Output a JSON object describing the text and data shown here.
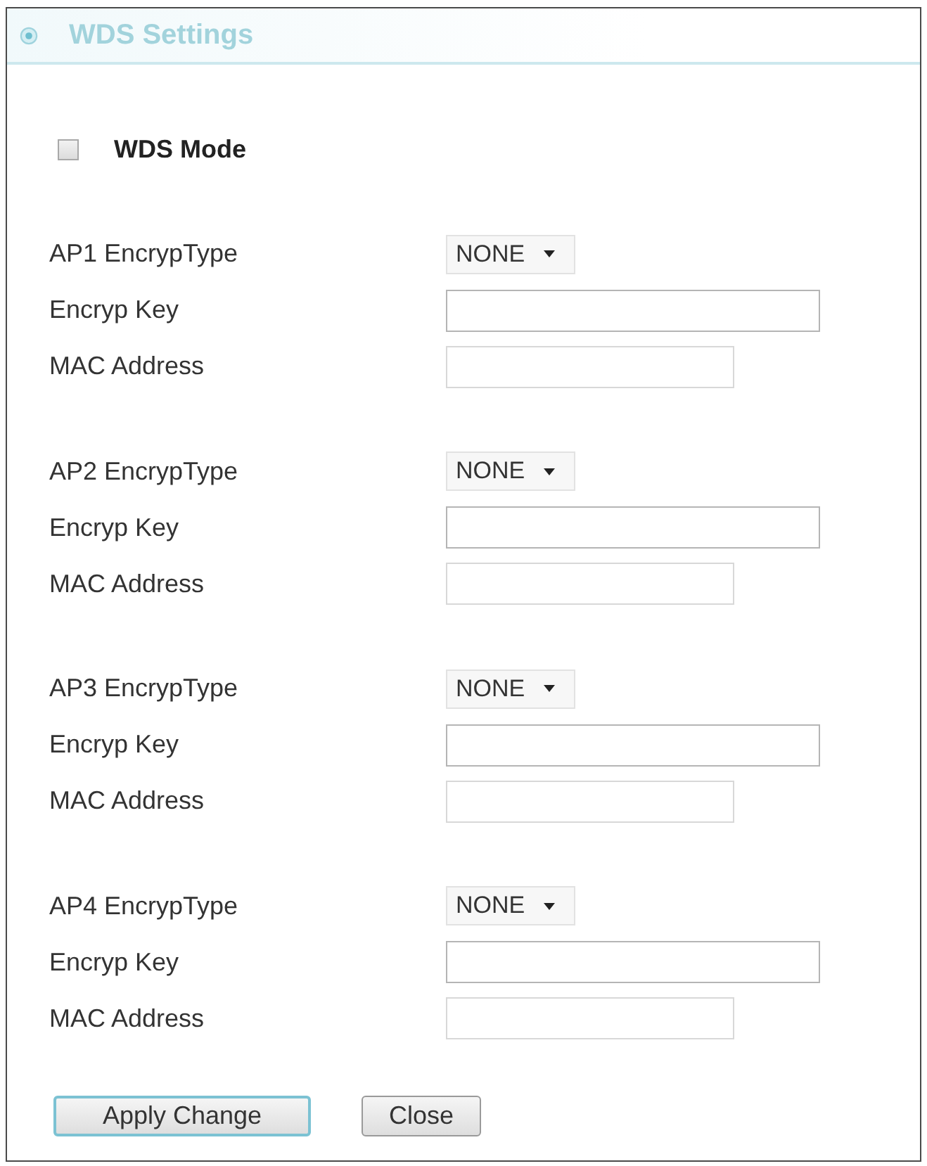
{
  "panel": {
    "title": "WDS Settings"
  },
  "wds_mode": {
    "label": "WDS Mode",
    "checked": false
  },
  "access_points": [
    {
      "rows": [
        {
          "kind": "select",
          "label": "AP1 EncrypType",
          "value": "NONE"
        },
        {
          "kind": "key",
          "label": "Encryp Key"
        },
        {
          "kind": "mac",
          "label": "MAC Address"
        }
      ]
    },
    {
      "rows": [
        {
          "kind": "select",
          "label": "AP2 EncrypType",
          "value": "NONE"
        },
        {
          "kind": "key",
          "label": "Encryp Key"
        },
        {
          "kind": "mac",
          "label": "MAC Address"
        }
      ]
    },
    {
      "rows": [
        {
          "kind": "select",
          "label": "AP3 EncrypType",
          "value": "NONE"
        },
        {
          "kind": "key",
          "label": "Encryp Key"
        },
        {
          "kind": "mac",
          "label": "MAC Address"
        }
      ]
    },
    {
      "rows": [
        {
          "kind": "select",
          "label": "AP4 EncrypType",
          "value": "NONE"
        },
        {
          "kind": "key",
          "label": "Encryp Key"
        },
        {
          "kind": "mac",
          "label": "MAC Address"
        }
      ]
    }
  ],
  "buttons": [
    {
      "label": "Apply Change",
      "kind": "primary"
    },
    {
      "label": "Close",
      "kind": "secondary"
    }
  ]
}
